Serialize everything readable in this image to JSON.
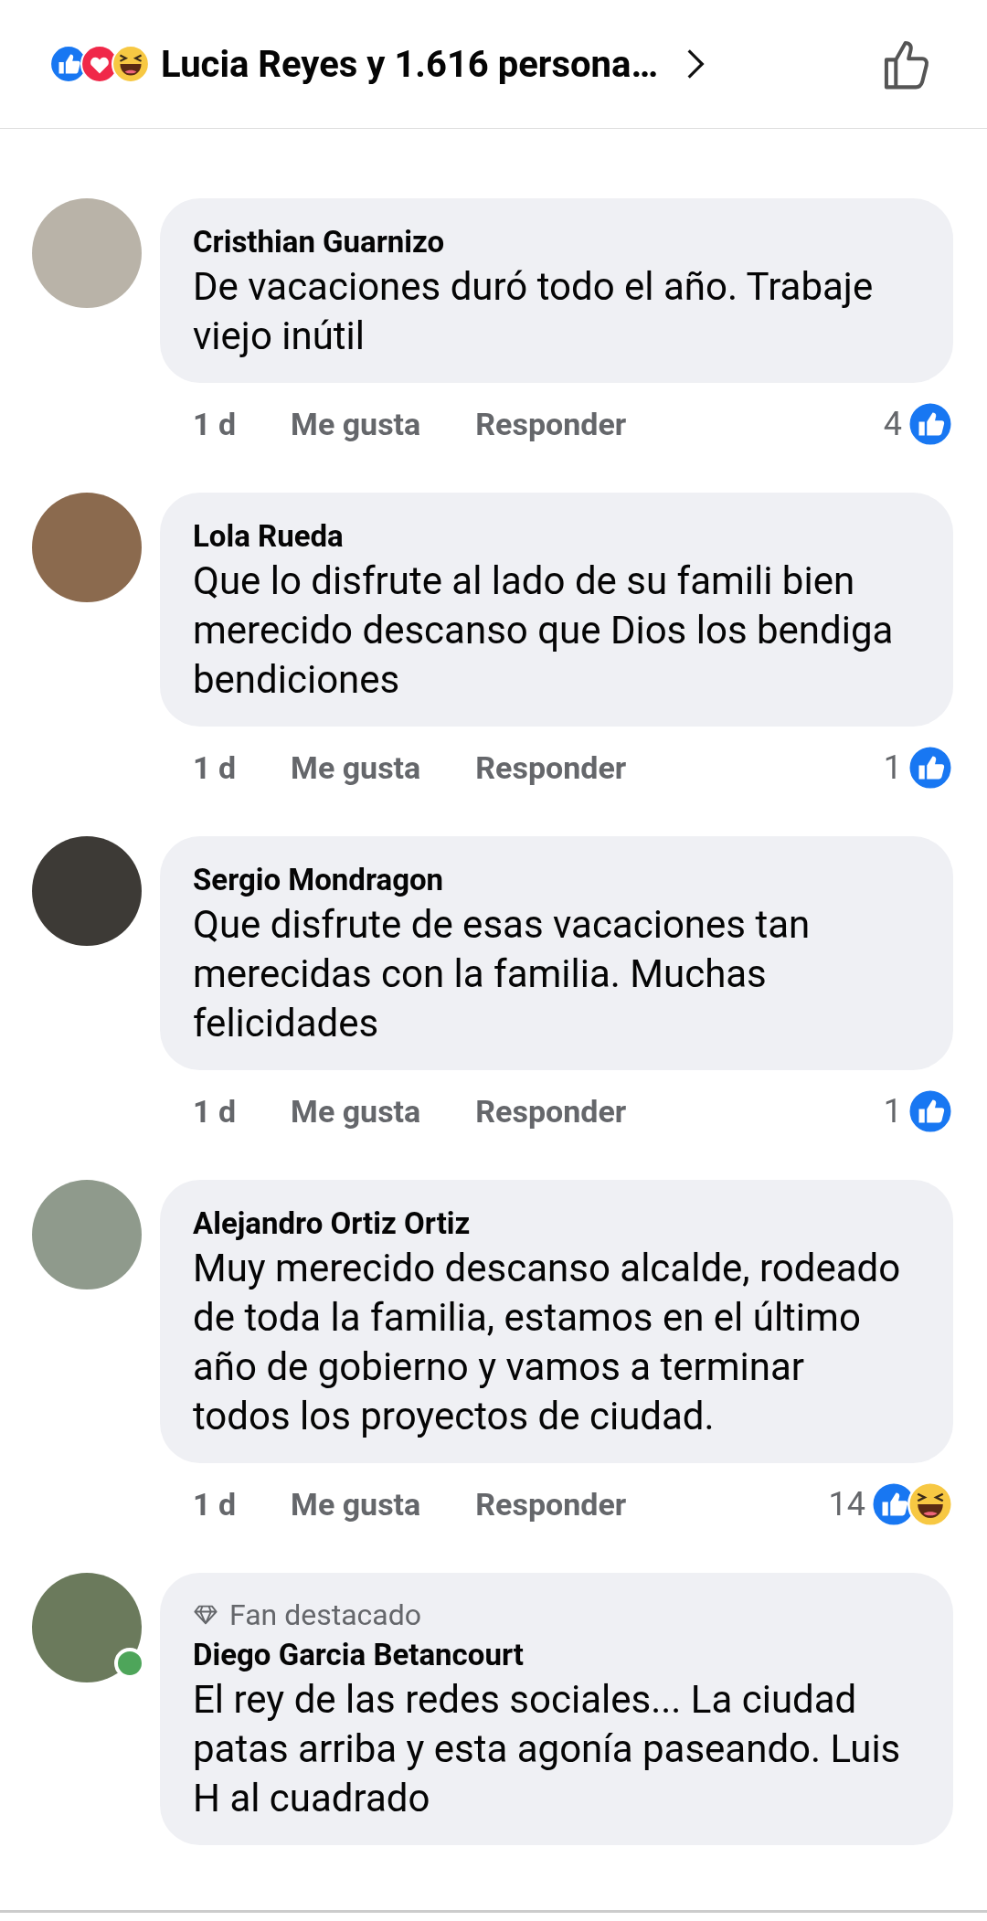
{
  "header": {
    "reactions": [
      {
        "kind": "like"
      },
      {
        "kind": "love"
      },
      {
        "kind": "haha"
      }
    ],
    "title": "Lucia Reyes y 1.616 persona…"
  },
  "comments": [
    {
      "name": "Cristhian Guarnizo",
      "text": "De vacaciones duró todo el año. Trabaje viejo inútil",
      "time": "1 d",
      "like_label": "Me gusta",
      "reply_label": "Responder",
      "reaction_count": "4",
      "reactions": [
        {
          "kind": "like"
        }
      ],
      "online": false
    },
    {
      "name": "Lola Rueda",
      "text": "Que lo disfrute al lado de su famili bien merecido descanso que Dios los bendiga bendiciones",
      "time": "1 d",
      "like_label": "Me gusta",
      "reply_label": "Responder",
      "reaction_count": "1",
      "reactions": [
        {
          "kind": "like"
        }
      ],
      "online": false
    },
    {
      "name": "Sergio Mondragon",
      "text": "Que disfrute de esas vacaciones tan merecidas con la familia. Muchas felicidades",
      "time": "1 d",
      "like_label": "Me gusta",
      "reply_label": "Responder",
      "reaction_count": "1",
      "reactions": [
        {
          "kind": "like"
        }
      ],
      "online": false
    },
    {
      "name": "Alejandro Ortiz Ortiz",
      "text": "Muy merecido descanso alcalde, rodeado de toda la familia,  estamos en el último año de gobierno y vamos a terminar todos los proyectos de ciudad.",
      "time": "1 d",
      "like_label": "Me gusta",
      "reply_label": "Responder",
      "reaction_count": "14",
      "reactions": [
        {
          "kind": "like"
        },
        {
          "kind": "haha"
        }
      ],
      "online": false
    },
    {
      "badge": "Fan destacado",
      "name": "Diego Garcia Betancourt",
      "text": "El rey de las redes sociales... La ciudad patas arriba y esta agonía paseando. Luis H al cuadrado",
      "online": true
    }
  ]
}
